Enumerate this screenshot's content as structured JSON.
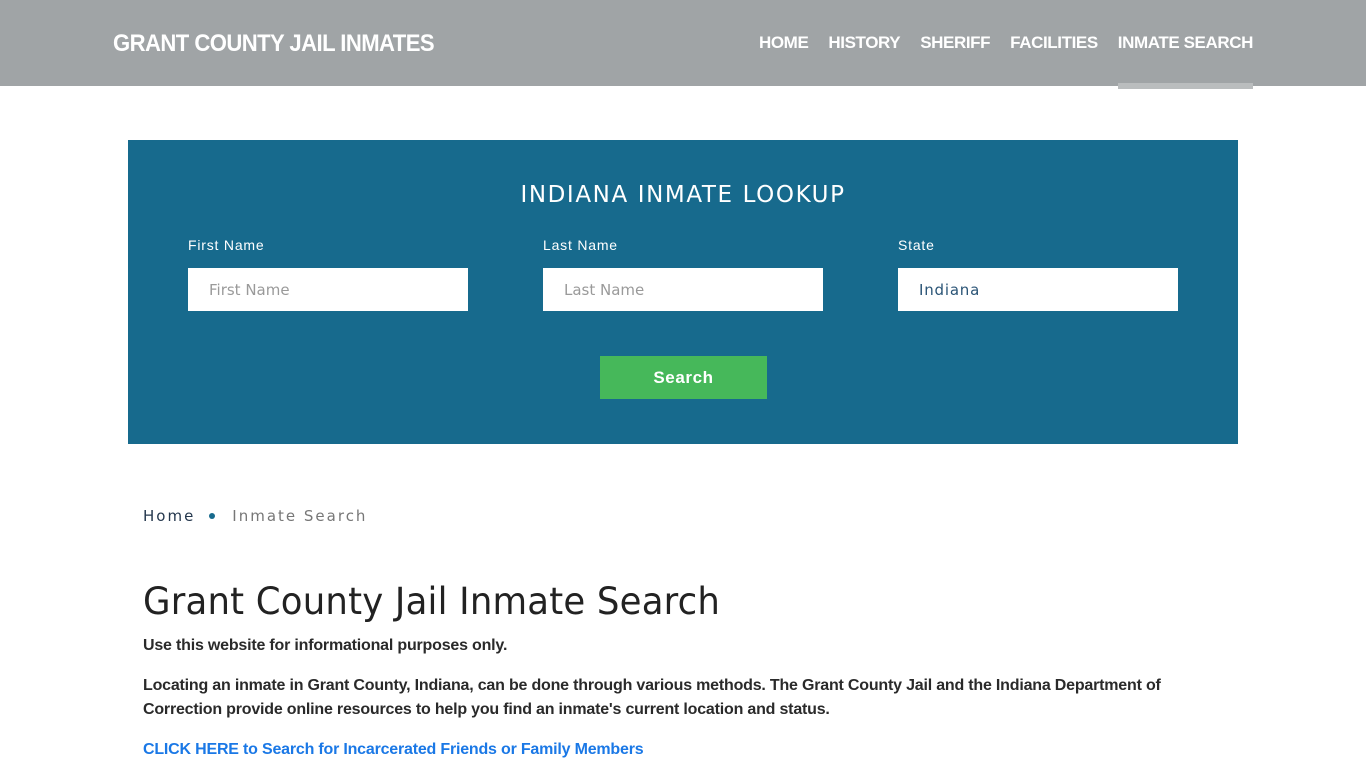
{
  "header": {
    "brand": "GRANT COUNTY JAIL INMATES",
    "nav": [
      {
        "label": "HOME",
        "active": false
      },
      {
        "label": "HISTORY",
        "active": false
      },
      {
        "label": "SHERIFF",
        "active": false
      },
      {
        "label": "FACILITIES",
        "active": false
      },
      {
        "label": "INMATE SEARCH",
        "active": true
      }
    ]
  },
  "lookup": {
    "title": "INDIANA INMATE LOOKUP",
    "first_name": {
      "label": "First Name",
      "placeholder": "First Name",
      "value": ""
    },
    "last_name": {
      "label": "Last Name",
      "placeholder": "Last Name",
      "value": ""
    },
    "state": {
      "label": "State",
      "value": "Indiana"
    },
    "search_label": "Search"
  },
  "breadcrumb": {
    "home": "Home",
    "current": "Inmate Search"
  },
  "main": {
    "title": "Grant County Jail Inmate Search",
    "paragraphs": [
      "Use this website for informational purposes only.",
      "Locating an inmate in Grant County, Indiana, can be done through various methods. The Grant County Jail and the Indiana Department of Correction provide online resources to help you find an inmate's current location and status."
    ],
    "cta_link": "CLICK HERE to Search for Incarcerated Friends or Family Members"
  },
  "colors": {
    "header_bg": "#a0a4a6",
    "lookup_bg": "#176a8d",
    "search_button": "#46b85a",
    "link": "#1a78e6"
  }
}
